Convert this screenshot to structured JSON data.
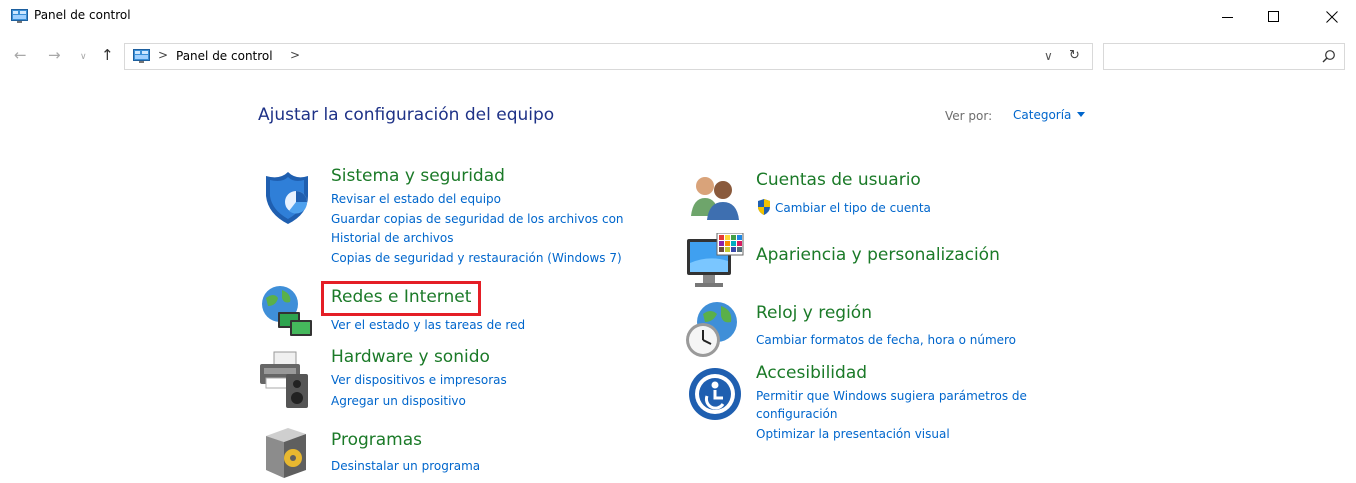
{
  "window": {
    "title": "Panel de control",
    "minimize": "—",
    "maximize": "☐",
    "close": "✕"
  },
  "address_bar": {
    "breadcrumb": [
      "Panel de control"
    ],
    "separator": ">",
    "dropdown": "∨",
    "refresh": "↻",
    "search_placeholder": ""
  },
  "content": {
    "title": "Ajustar la configuración del equipo",
    "view_by_label": "Ver por:",
    "view_by_value": "Categoría"
  },
  "categories_left": [
    {
      "title": "Sistema y seguridad",
      "icon": "shield-security-icon",
      "links": [
        "Revisar el estado del equipo",
        "Guardar copias de seguridad de los archivos con",
        "Historial de archivos",
        "Copias de seguridad y restauración (Windows 7)"
      ]
    },
    {
      "title": "Redes e Internet",
      "icon": "network-globe-icon",
      "links": [
        "Ver el estado y las tareas de red"
      ]
    },
    {
      "title": "Hardware y sonido",
      "icon": "printer-speaker-icon",
      "links": [
        "Ver dispositivos e impresoras",
        "Agregar un dispositivo"
      ]
    },
    {
      "title": "Programas",
      "icon": "programs-box-icon",
      "links": [
        "Desinstalar un programa"
      ]
    }
  ],
  "categories_right": [
    {
      "title": "Cuentas de usuario",
      "icon": "users-icon",
      "links": [
        "Cambiar el tipo de cuenta"
      ],
      "link_icon": "uac-shield-icon"
    },
    {
      "title": "Apariencia y personalización",
      "icon": "monitor-palette-icon",
      "links": []
    },
    {
      "title": "Reloj y región",
      "icon": "clock-globe-icon",
      "links": [
        "Cambiar formatos de fecha, hora o número"
      ]
    },
    {
      "title": "Accesibilidad",
      "icon": "accessibility-icon",
      "links": [
        "Permitir que Windows sugiera parámetros de",
        "configuración",
        "Optimizar la presentación visual"
      ]
    }
  ],
  "colors": {
    "category_title": "#1b7a28",
    "link": "#0066cc",
    "heading": "#1e3287",
    "highlight": "#e41e26"
  }
}
